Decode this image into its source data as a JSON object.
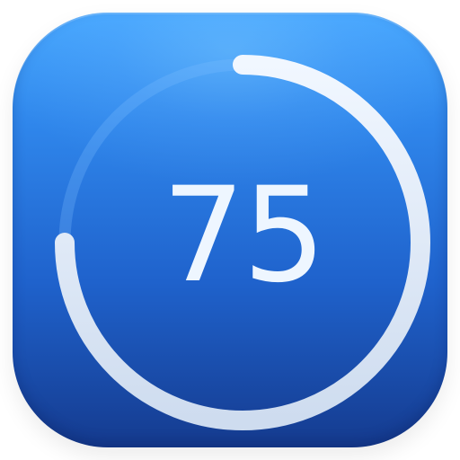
{
  "gauge": {
    "value": "75",
    "progress_fraction": 0.75,
    "colors": {
      "track": "#7ebfff",
      "progress": "#dbe8f6",
      "text": "#eef6ff"
    }
  },
  "theme": {
    "icon_background_top": "#45a6ff",
    "icon_background_bottom": "#153b8f"
  }
}
